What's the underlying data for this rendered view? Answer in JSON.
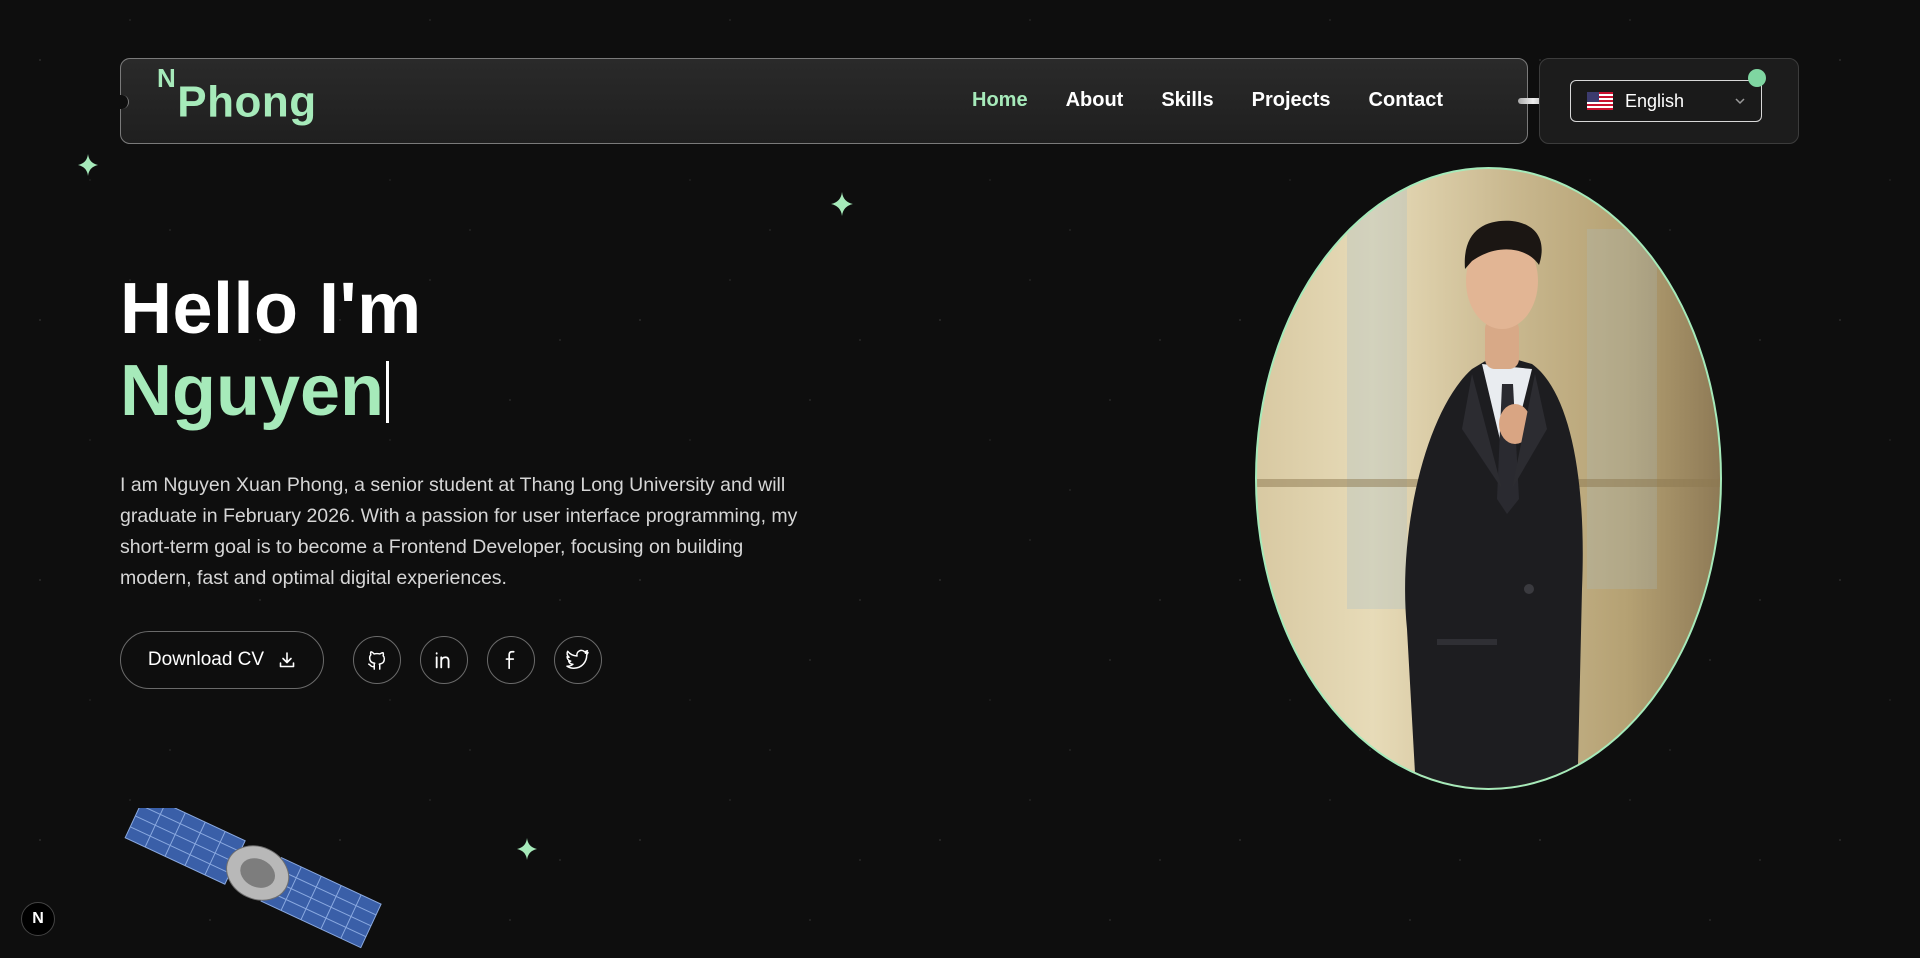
{
  "header": {
    "logo_sup": "N",
    "logo_text": "Phong",
    "nav": [
      {
        "label": "Home",
        "active": true
      },
      {
        "label": "About",
        "active": false
      },
      {
        "label": "Skills",
        "active": false
      },
      {
        "label": "Projects",
        "active": false
      },
      {
        "label": "Contact",
        "active": false
      }
    ],
    "language": {
      "selected": "English",
      "flag": "us-flag-icon"
    }
  },
  "hero": {
    "greeting": "Hello I'm",
    "name": "Nguyen",
    "intro": "I am Nguyen Xuan Phong, a senior student at Thang Long University and will graduate in February 2026. With a passion for user interface programming, my short-term goal is to become a Frontend Developer, focusing on building modern, fast and optimal digital experiences.",
    "download_label": "Download CV",
    "socials": [
      "github-icon",
      "linkedin-icon",
      "facebook-icon",
      "twitter-icon"
    ]
  },
  "framework_badge": "N",
  "colors": {
    "accent": "#a6eaba",
    "background": "#0e0e0e",
    "text": "#ffffff"
  }
}
